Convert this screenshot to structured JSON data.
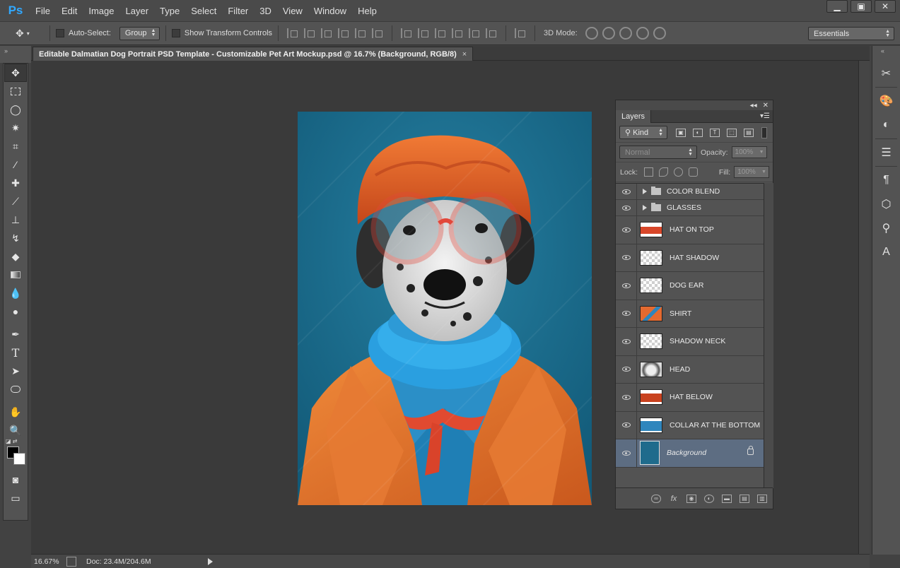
{
  "app": {
    "logo": "Ps"
  },
  "menu": [
    "File",
    "Edit",
    "Image",
    "Layer",
    "Type",
    "Select",
    "Filter",
    "3D",
    "View",
    "Window",
    "Help"
  ],
  "window_controls": [
    "minimize-icon",
    "maximize-icon",
    "close-icon"
  ],
  "options_bar": {
    "auto_select_label": "Auto-Select:",
    "auto_select_value": "Group",
    "show_transform_label": "Show Transform Controls",
    "mode_label": "3D Mode:",
    "workspace": "Essentials"
  },
  "document": {
    "tab_title": "Editable Dalmatian Dog Portrait PSD Template - Customizable Pet Art Mockup.psd @ 16.7% (Background, RGB/8)",
    "close": "×"
  },
  "layers_panel": {
    "tab": "Layers",
    "filter_kind": "Kind",
    "blend_mode": "Normal",
    "opacity_label": "Opacity:",
    "opacity_value": "100%",
    "lock_label": "Lock:",
    "fill_label": "Fill:",
    "fill_value": "100%",
    "layers": [
      {
        "name": "COLOR BLEND",
        "type": "group"
      },
      {
        "name": "GLASSES",
        "type": "group"
      },
      {
        "name": "HAT ON TOP",
        "type": "layer",
        "thumb": "#d8472a"
      },
      {
        "name": "HAT SHADOW",
        "type": "layer",
        "thumb": "checker"
      },
      {
        "name": "DOG EAR",
        "type": "layer",
        "thumb": "checker"
      },
      {
        "name": "SHIRT",
        "type": "layer",
        "thumb": "#e46a30"
      },
      {
        "name": "SHADOW NECK",
        "type": "layer",
        "thumb": "checker"
      },
      {
        "name": "HEAD",
        "type": "layer",
        "thumb": "#b9b9b9"
      },
      {
        "name": "HAT BELOW",
        "type": "layer",
        "thumb": "#c9421f"
      },
      {
        "name": "COLLAR AT THE BOTTOM",
        "type": "layer",
        "thumb": "#2f86bd"
      },
      {
        "name": "Background",
        "type": "layer",
        "thumb": "#1f6b8c",
        "selected": true,
        "locked": true
      }
    ]
  },
  "status": {
    "zoom": "16.67%",
    "doc": "Doc: 23.4M/204.6M"
  },
  "colors": {
    "accent": "#31a8ff",
    "canvas_bg": "#1b6b8a",
    "coat": "#e7762d",
    "hat": "#e2662b",
    "scarf": "#2b9ad8",
    "glasses": "#e2473a"
  }
}
